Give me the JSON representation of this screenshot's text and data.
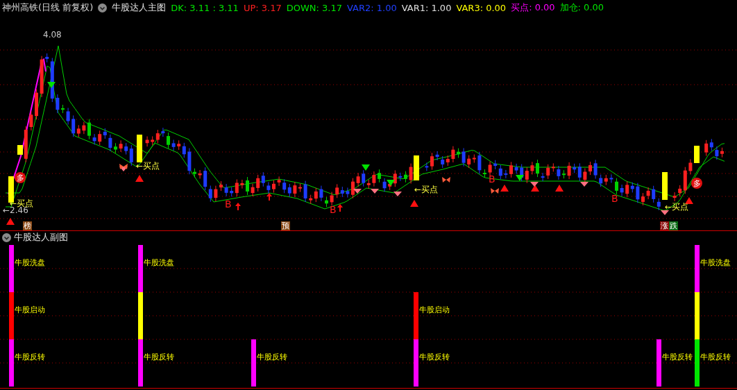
{
  "header": {
    "security": "神州高铁(日线 前复权)",
    "indicator_name": "牛股达人主图",
    "values": [
      {
        "text": "DK: 3.11 : 3.11",
        "color": "#00e600"
      },
      {
        "text": "UP: 3.17",
        "color": "#ff2020"
      },
      {
        "text": "DOWN: 3.17",
        "color": "#00e600"
      },
      {
        "text": "VAR2: 1.00",
        "color": "#2040ff"
      },
      {
        "text": "VAR1: 1.00",
        "color": "#e0e0e0"
      },
      {
        "text": "VAR3: 0.00",
        "color": "#ffff00"
      },
      {
        "text": "买点: 0.00",
        "color": "#ff00ff"
      },
      {
        "text": "加仓: 0.00",
        "color": "#00e600"
      }
    ]
  },
  "main_chart": {
    "price_labels": [
      "4.08",
      "←2.46"
    ],
    "buy_labels": [
      "←买点",
      "←买点",
      "←买点",
      "←买点"
    ],
    "badges": [
      "多",
      "多"
    ],
    "letters": [
      "B",
      "B",
      "B",
      "B"
    ],
    "tags": [
      {
        "text": "榜",
        "color": "#8b4a16"
      },
      {
        "text": "预",
        "color": "#8b4a16"
      },
      {
        "text": "涨",
        "color": "#8b0a0a"
      },
      {
        "text": "跌",
        "color": "#0a6a14"
      }
    ]
  },
  "sub_chart": {
    "title": "牛股达人副图",
    "columns": [
      {
        "segments": [
          {
            "kind": "top",
            "color": "#ff00ff",
            "label": "牛股洗盘"
          },
          {
            "kind": "middle",
            "color": "#ff0000",
            "label": "牛股启动"
          },
          {
            "kind": "bottom",
            "color": "#ff00ff",
            "label": "牛股反转"
          }
        ]
      },
      {
        "segments": [
          {
            "kind": "top",
            "color": "#ff00ff",
            "label": "牛股洗盘"
          },
          {
            "kind": "middle",
            "color": "#ffff00"
          },
          {
            "kind": "bottom",
            "color": "#ff00ff",
            "label": "牛股反转"
          }
        ]
      },
      {
        "segments": [
          {
            "kind": "bottom",
            "color": "#ff00ff",
            "label": "牛股反转"
          }
        ]
      },
      {
        "segments": [
          {
            "kind": "middle",
            "color": "#ff0000",
            "label": "牛股启动"
          },
          {
            "kind": "bottom",
            "color": "#ff00ff",
            "label": "牛股反转"
          }
        ]
      },
      {
        "segments": [
          {
            "kind": "bottom",
            "color": "#ff00ff",
            "label": "牛股反转"
          }
        ]
      },
      {
        "segments": [
          {
            "kind": "top",
            "color": "#ff00ff",
            "label": "牛股洗盘"
          },
          {
            "kind": "middle",
            "color": "#ffff00"
          },
          {
            "kind": "bottom",
            "color": "#00e600",
            "label": "牛股反转"
          }
        ]
      }
    ]
  }
}
